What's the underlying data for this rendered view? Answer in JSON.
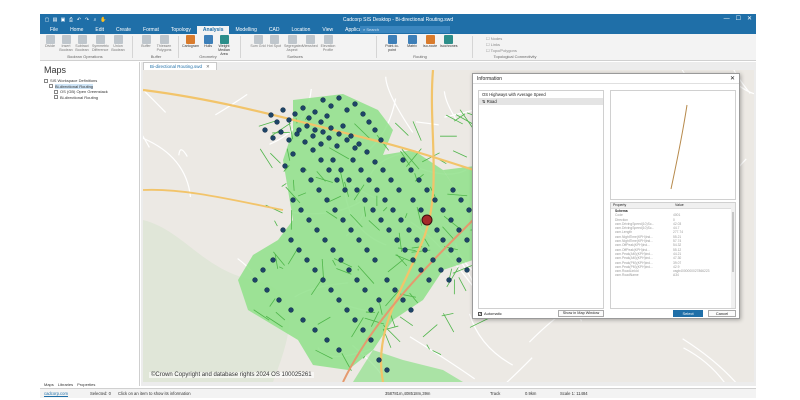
{
  "window": {
    "title": "Cadcorp SIS Desktop - Bi-directional Routing.swd",
    "controls": [
      "—",
      "☐",
      "✕"
    ]
  },
  "menu": {
    "tabs": [
      "File",
      "Home",
      "Edit",
      "Create",
      "Format",
      "Topology",
      "Analysis",
      "Modelling",
      "CAD",
      "Location",
      "View",
      "Applications"
    ],
    "active": "Analysis",
    "search_placeholder": "Search"
  },
  "ribbon": {
    "buttons": [
      "Divide",
      "Insert Boolean",
      "Subtract Boolean",
      "Symmetric Difference",
      "Union Boolean",
      "Buffer",
      "Thiessen Polygons",
      "Cartogram",
      "Hulls",
      "Weight Median Area",
      "Sum Grid",
      "Hot Spot",
      "Segregated Aspect",
      "Viewshed",
      "Elevation Profile",
      "Point-to-point",
      "Matrix",
      "Iso-route",
      "Isochrones"
    ],
    "groups": [
      "Boolean Operations",
      "Buffer",
      "Geometry",
      "Surfaces",
      "Routing",
      "Topological Connectivity"
    ],
    "checks": [
      "Nodes",
      "Links",
      "Topo/Polygons"
    ]
  },
  "left_panel": {
    "title": "Maps",
    "tree": [
      {
        "label": "SIS Workspace Definitions",
        "level": 0
      },
      {
        "label": "Bi-directional Routing",
        "level": 1
      },
      {
        "label": "OS (GB) Open Greenstack",
        "level": 2
      },
      {
        "label": "Bi-directional Routing",
        "level": 2
      }
    ],
    "tabs": [
      "Maps",
      "Libraries",
      "Properties"
    ]
  },
  "document_tab": {
    "label": "Bi-directional Routing.swd"
  },
  "map": {
    "copyright": "©Crown Copyright and database rights 2024 OS 100025261"
  },
  "info_dialog": {
    "title": "Information",
    "tree_items": [
      "OS Highways with Average Speed",
      "Road"
    ],
    "property_header": {
      "property": "Property",
      "value": "Value"
    },
    "properties": [
      {
        "property": "Schema",
        "value": "",
        "group": true
      },
      {
        "property": "Code",
        "value": "4001"
      },
      {
        "property": "Direction",
        "value": "0"
      },
      {
        "property": "csm.DrivingSpeed(10)Sc...",
        "value": "42.03"
      },
      {
        "property": "csm.DrivingSpeed(10)Sc...",
        "value": "44.7"
      },
      {
        "property": "csm.Length",
        "value": "277.74"
      },
      {
        "property": "csm.NightTime(KPH)ind...",
        "value": "55.21"
      },
      {
        "property": "csm.NightTime(KPH)ind...",
        "value": "57.74"
      },
      {
        "property": "csm.OffPeak(KPH)ind...",
        "value": "54.32"
      },
      {
        "property": "csm.OffPeak(KPH)ind...",
        "value": "55.12"
      },
      {
        "property": "csm.Peak(AM)(KPH)ind...",
        "value": "44.21"
      },
      {
        "property": "csm.Peak(AM)(KPH)ind...",
        "value": "47.30"
      },
      {
        "property": "csm.Peak(PM)(KPH)ind...",
        "value": "39.07"
      },
      {
        "property": "csm.Peak(PM)(KPH)ind...",
        "value": "42.9"
      },
      {
        "property": "csm.RoadLinkId",
        "value": "osgb4000000027866223"
      },
      {
        "property": "csm.RoadName",
        "value": "A34"
      }
    ],
    "automatic_label": "Automatic",
    "automatic_checked": true,
    "show_in_map_label": "Show in Map Window",
    "select_label": "Select",
    "cancel_label": "Cancel"
  },
  "status": {
    "link": "cadcorp.com",
    "selected": "Selected: 0",
    "hint": "Click on an item to show its information",
    "coords": "358781m,408518m,39m",
    "track": "Track",
    "range": "0.9km",
    "scale": "Scale 1: 11484"
  },
  "colors": {
    "accent": "#1f6fa8",
    "isochrone_fill": "#8fe08a",
    "point_fill": "#1e4467",
    "origin_fill": "#a52a2a"
  }
}
